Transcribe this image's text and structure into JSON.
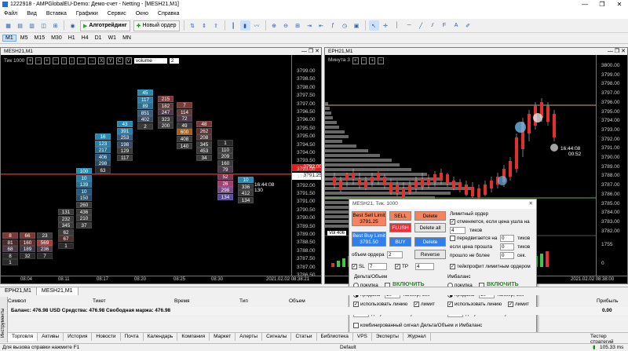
{
  "window": {
    "title": "1222918 - AMPGlobalEU-Demo: Демо-счет - Netting - [MESH21,M1]",
    "controls": [
      "—",
      "❐",
      "✕"
    ]
  },
  "menu": [
    "Файл",
    "Вид",
    "Вставка",
    "Графики",
    "Сервис",
    "Окно",
    "Справка"
  ],
  "toolbar": {
    "algo_label": "Алготрейдинг",
    "new_order_label": "Новый ордер"
  },
  "timeframes": [
    "M1",
    "M5",
    "M15",
    "M30",
    "H1",
    "H4",
    "D1",
    "W1",
    "MN"
  ],
  "left_chart": {
    "title": "MESH21,M1",
    "indicator_label": "Тик  1000",
    "select_value": "volume",
    "select_num": "2",
    "price_ticks": [
      "3799.00",
      "3798.50",
      "3798.00",
      "3797.50",
      "3797.00",
      "3796.50",
      "3796.00",
      "3795.50",
      "3795.00",
      "3794.50",
      "3794.00",
      "3793.50",
      "3793.00",
      "3792.50",
      "3792.00",
      "3791.50",
      "3791.00",
      "3790.50",
      "3790.00",
      "3789.50",
      "3789.00",
      "3788.50",
      "3788.00",
      "3787.50",
      "3787.00",
      "3786.50",
      "3786.00"
    ],
    "current_price": "3792.00",
    "bid_price": "3791.25",
    "timer": "16:44:08",
    "timer_sub": "130",
    "time_ticks": [
      "08:04",
      "08:11",
      "08:17",
      "08:20",
      "08:25",
      "08:30"
    ],
    "date_label": "2021.02.02 08:38:21"
  },
  "right_chart": {
    "title": "EPH21,M1",
    "indicator_label": "Минута  3",
    "price_ticks": [
      "3800.00",
      "3799.00",
      "3798.00",
      "3797.00",
      "3796.00",
      "3795.00",
      "3794.00",
      "3793.00",
      "3792.00",
      "3791.00",
      "3790.00",
      "3789.00",
      "3788.00",
      "3787.00",
      "3786.00",
      "3785.00",
      "3784.00",
      "3783.00",
      "3782.00",
      "1755",
      "0"
    ],
    "timer": "16:44:08",
    "timer_sub": "00:52",
    "vol_label": "Vol 406",
    "date_label": "2021.02.02 08:38:00"
  },
  "dialog": {
    "title": "MESH21, Тик. 1000",
    "sell_limit": "Best Sell Limit",
    "sell_limit_price": "3791.25",
    "buy_limit": "Best Buy Limit",
    "buy_limit_price": "3791.50",
    "sell": "SELL",
    "buy": "BUY",
    "flush": "FLUSH",
    "delete": "Delete",
    "delete_all": "Delete all",
    "reverse": "Reverse",
    "volume_label": "объем ордера",
    "volume_value": "2",
    "sl_label": "SL",
    "sl_value": "7",
    "tp_label": "TP",
    "tp_value": "4",
    "limit_title": "Лимитный ордер",
    "limit_cancel": "отменяется, если цена ушла на",
    "limit_ticks_value": "4",
    "ticks": "тиков",
    "move_label": "передвигается на",
    "move_value": "0",
    "if_passed": "если цена прошла",
    "if_passed_value": "0",
    "passed_no_more": "прошло не более",
    "passed_no_more_value": "0",
    "sec": "сек.",
    "takeprofit": "тейкпрофит лимитным ордером",
    "delta_title": "Дельта/Объем",
    "imbalance_title": "Имбаланс",
    "enable": "ВКЛЮЧИТЬ",
    "buy_radio": "покупка",
    "sell_radio": "продажа",
    "timer_label": "таймер, сек",
    "timer_value": "10",
    "use_line": "использовать линию",
    "limit_chk": "лимит",
    "allow_label": "допуск по сигналу в тиках",
    "allow_value": "1",
    "combined": "комбинированный сигнал Дельта/Объем и Имбаланс"
  },
  "chart_tabs": [
    "EPH21,M1",
    "MESH21,M1"
  ],
  "terminal": {
    "headers": [
      "Символ",
      "Тикет",
      "Время",
      "Тип",
      "Объем",
      "Прибыль"
    ],
    "balance_row": "Баланс: 476.98 USD  Средства: 476.98  Свободная маржа: 476.98",
    "balance_profit": "0.00",
    "tabs": [
      "Торговля",
      "Активы",
      "История",
      "Новости",
      "Почта",
      "Календарь",
      "Компания",
      "Маркет",
      "Алерты",
      "Сигналы",
      "Статьи",
      "Библиотека",
      "VPS",
      "Эксперты",
      "Журнал"
    ],
    "strategy_tester": "Тестер стратегий",
    "side_label": "Инструменты"
  },
  "status": {
    "help": "Для вызова справки нажмите F1",
    "profile": "Default",
    "net": "105.33 ms"
  },
  "colors": {
    "sell": "#f4845f",
    "buy": "#2f80ed",
    "flush": "#e8313a",
    "price_line": "#e02020"
  }
}
